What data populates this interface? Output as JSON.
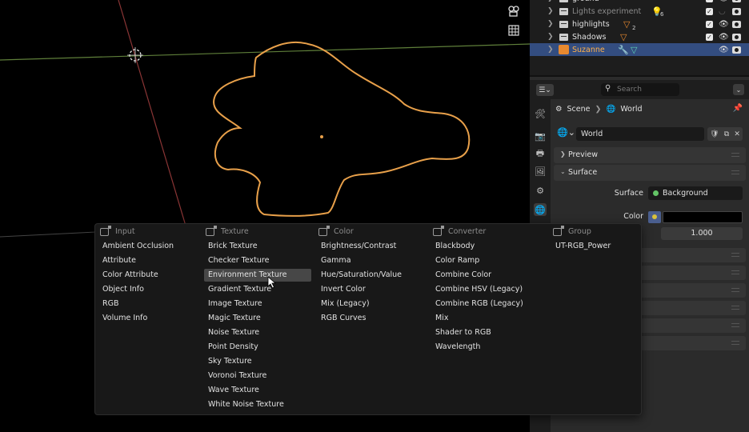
{
  "outliner": {
    "rows": [
      {
        "label": "ground"
      },
      {
        "label": "Lights experiment",
        "sub": "6"
      },
      {
        "label": "highlights",
        "sub": "2"
      },
      {
        "label": "Shadows"
      },
      {
        "label": "Suzanne"
      }
    ]
  },
  "properties": {
    "search_placeholder": "Search",
    "breadcrumb": {
      "scene": "Scene",
      "world": "World"
    },
    "world_name": "World",
    "panels": {
      "preview": "Preview",
      "surface": "Surface"
    },
    "surface_label": "Surface",
    "surface_value": "Background",
    "color_label": "Color",
    "strength_value": "1.000"
  },
  "menu": {
    "columns": [
      {
        "header": "Input",
        "items": [
          "Ambient Occlusion",
          "Attribute",
          "Color Attribute",
          "Object Info",
          "RGB",
          "Volume Info"
        ]
      },
      {
        "header": "Texture",
        "items": [
          "Brick Texture",
          "Checker Texture",
          "Environment Texture",
          "Gradient Texture",
          "Image Texture",
          "Magic Texture",
          "Noise Texture",
          "Point Density",
          "Sky Texture",
          "Voronoi Texture",
          "Wave Texture",
          "White Noise Texture"
        ]
      },
      {
        "header": "Color",
        "items": [
          "Brightness/Contrast",
          "Gamma",
          "Hue/Saturation/Value",
          "Invert Color",
          "Mix (Legacy)",
          "RGB Curves"
        ]
      },
      {
        "header": "Converter",
        "items": [
          "Blackbody",
          "Color Ramp",
          "Combine Color",
          "Combine HSV (Legacy)",
          "Combine RGB (Legacy)",
          "Mix",
          "Shader to RGB",
          "Wavelength"
        ]
      },
      {
        "header": "Group",
        "items": [
          "UT-RGB_Power"
        ]
      }
    ],
    "hovered_item": "Environment Texture"
  },
  "colors": {
    "selection_outline": "#e8a04a",
    "selected_row": "#334d80",
    "menu_bg": "#181818",
    "hover_bg": "#474747"
  }
}
